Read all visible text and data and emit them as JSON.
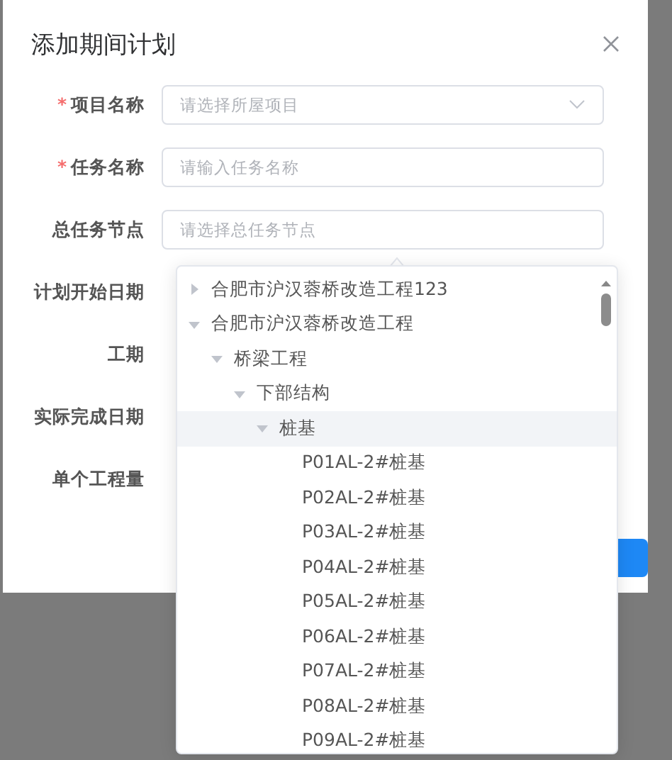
{
  "dialog": {
    "title": "添加期间计划"
  },
  "form": {
    "fields": [
      {
        "label": "项目名称",
        "required_mark": "*",
        "kind": "select",
        "placeholder": "请选择所屋项目"
      },
      {
        "label": "任务名称",
        "required_mark": "*",
        "kind": "input",
        "placeholder": "请输入任务名称"
      },
      {
        "label": "总任务节点",
        "kind": "input",
        "placeholder": "请选择总任务节点"
      },
      {
        "label": "计划开始日期",
        "kind": "hidden"
      },
      {
        "label": "工期",
        "kind": "hidden"
      },
      {
        "label": "实际完成日期",
        "kind": "hidden"
      },
      {
        "label": "单个工程量",
        "kind": "hidden"
      }
    ]
  },
  "tree": [
    {
      "label": "合肥市沪汉蓉桥改造工程123",
      "expanded": false,
      "highlighted": false
    },
    {
      "label": "合肥市沪汉蓉桥改造工程",
      "expanded": true,
      "highlighted": false,
      "children": [
        {
          "label": "桥梁工程",
          "expanded": true,
          "highlighted": false,
          "children": [
            {
              "label": "下部结构",
              "expanded": true,
              "highlighted": false,
              "children": [
                {
                  "label": "桩基",
                  "expanded": true,
                  "highlighted": true,
                  "children": [
                    {
                      "label": "P01AL-2#桩基",
                      "highlighted": false
                    },
                    {
                      "label": "P02AL-2#桩基",
                      "highlighted": false
                    },
                    {
                      "label": "P03AL-2#桩基",
                      "highlighted": false
                    },
                    {
                      "label": "P04AL-2#桩基",
                      "highlighted": false
                    },
                    {
                      "label": "P05AL-2#桩基",
                      "highlighted": false
                    },
                    {
                      "label": "P06AL-2#桩基",
                      "highlighted": false
                    },
                    {
                      "label": "P07AL-2#桩基",
                      "highlighted": false
                    },
                    {
                      "label": "P08AL-2#桩基",
                      "highlighted": false
                    },
                    {
                      "label": "P09AL-2#桩基",
                      "highlighted": false
                    }
                  ]
                }
              ]
            }
          ]
        }
      ]
    }
  ]
}
